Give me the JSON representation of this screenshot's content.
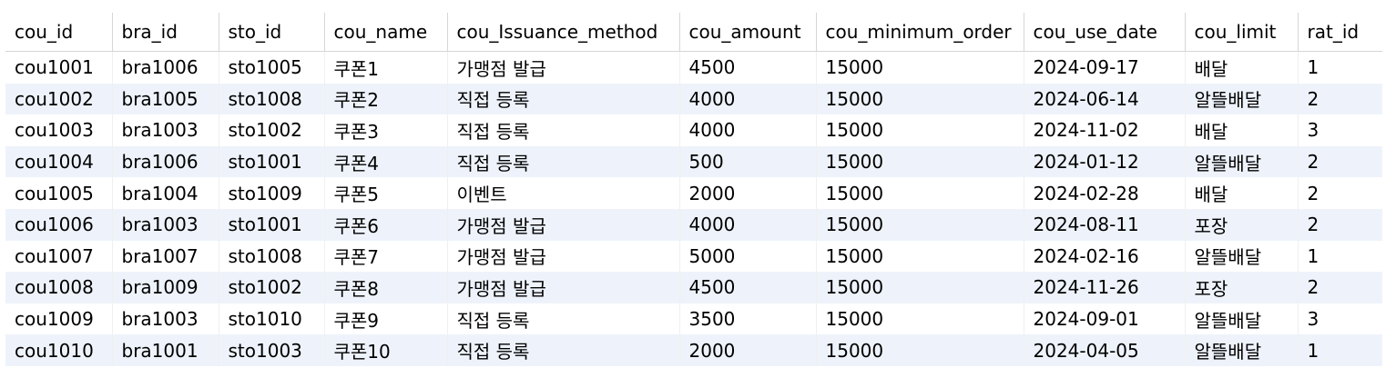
{
  "columns": [
    "cou_id",
    "bra_id",
    "sto_id",
    "cou_name",
    "cou_Issuance_method",
    "cou_amount",
    "cou_minimum_order",
    "cou_use_date",
    "cou_limit",
    "rat_id"
  ],
  "rows": [
    [
      "cou1001",
      "bra1006",
      "sto1005",
      "쿠폰1",
      "가맹점 발급",
      "4500",
      "15000",
      "2024-09-17",
      "배달",
      "1"
    ],
    [
      "cou1002",
      "bra1005",
      "sto1008",
      "쿠폰2",
      "직접 등록",
      "4000",
      "15000",
      "2024-06-14",
      "알뜰배달",
      "2"
    ],
    [
      "cou1003",
      "bra1003",
      "sto1002",
      "쿠폰3",
      "직접 등록",
      "4000",
      "15000",
      "2024-11-02",
      "배달",
      "3"
    ],
    [
      "cou1004",
      "bra1006",
      "sto1001",
      "쿠폰4",
      "직접 등록",
      "500",
      "15000",
      "2024-01-12",
      "알뜰배달",
      "2"
    ],
    [
      "cou1005",
      "bra1004",
      "sto1009",
      "쿠폰5",
      "이벤트",
      "2000",
      "15000",
      "2024-02-28",
      "배달",
      "2"
    ],
    [
      "cou1006",
      "bra1003",
      "sto1001",
      "쿠폰6",
      "가맹점 발급",
      "4000",
      "15000",
      "2024-08-11",
      "포장",
      "2"
    ],
    [
      "cou1007",
      "bra1007",
      "sto1008",
      "쿠폰7",
      "가맹점 발급",
      "5000",
      "15000",
      "2024-02-16",
      "알뜰배달",
      "1"
    ],
    [
      "cou1008",
      "bra1009",
      "sto1002",
      "쿠폰8",
      "가맹점 발급",
      "4500",
      "15000",
      "2024-11-26",
      "포장",
      "2"
    ],
    [
      "cou1009",
      "bra1003",
      "sto1010",
      "쿠폰9",
      "직접 등록",
      "3500",
      "15000",
      "2024-09-01",
      "알뜰배달",
      "3"
    ],
    [
      "cou1010",
      "bra1001",
      "sto1003",
      "쿠폰10",
      "직접 등록",
      "2000",
      "15000",
      "2024-04-05",
      "알뜰배달",
      "1"
    ]
  ],
  "colors": {
    "stripe": "#eef3fb",
    "header_border": "#d6d6d6"
  }
}
